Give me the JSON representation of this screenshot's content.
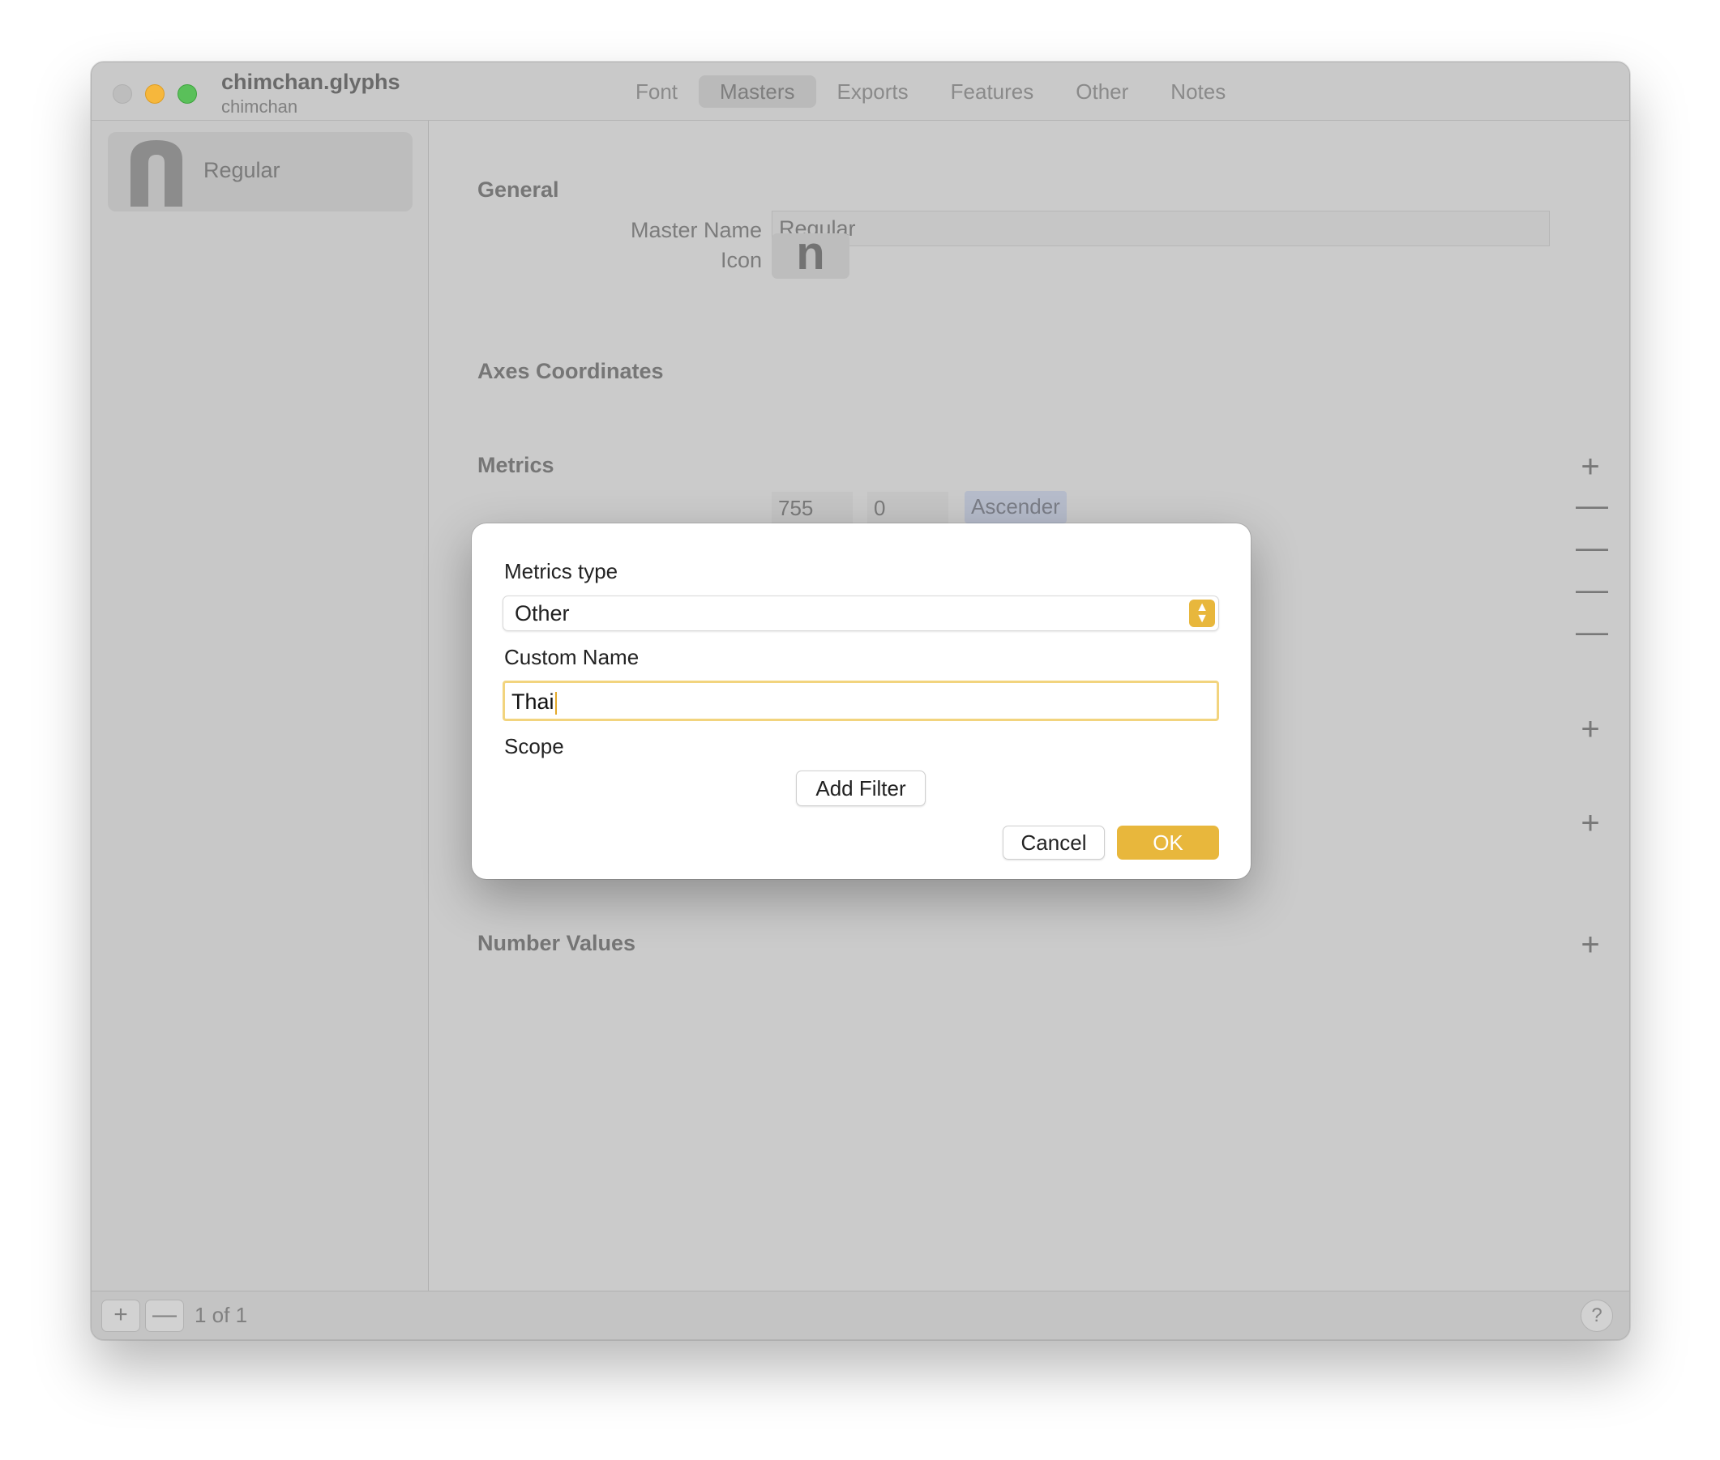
{
  "window": {
    "title": "chimchan.glyphs",
    "subtitle": "chimchan"
  },
  "tabs": [
    {
      "label": "Font",
      "active": false
    },
    {
      "label": "Masters",
      "active": true
    },
    {
      "label": "Exports",
      "active": false
    },
    {
      "label": "Features",
      "active": false
    },
    {
      "label": "Other",
      "active": false
    },
    {
      "label": "Notes",
      "active": false
    }
  ],
  "sidebar": {
    "items": [
      {
        "label": "Regular",
        "icon": "master-n-glyph-icon"
      }
    ]
  },
  "bottom_bar": {
    "add_symbol": "+",
    "remove_symbol": "—",
    "counter": "1 of 1",
    "help_symbol": "?"
  },
  "main": {
    "general": {
      "title": "General",
      "master_name_label": "Master Name",
      "master_name_value": "Regular",
      "icon_label": "Icon",
      "icon_glyph": "n"
    },
    "axes": {
      "title": "Axes Coordinates"
    },
    "metrics": {
      "title": "Metrics",
      "add_symbol": "+",
      "remove_symbol": "—",
      "rows": [
        {
          "value": "755",
          "overshoot": "0",
          "name": "Ascender"
        }
      ]
    },
    "number_values": {
      "title": "Number Values"
    }
  },
  "dialog": {
    "metrics_type_label": "Metrics type",
    "metrics_type_value": "Other",
    "custom_name_label": "Custom Name",
    "custom_name_value": "Thai",
    "scope_label": "Scope",
    "add_filter_label": "Add Filter",
    "cancel_label": "Cancel",
    "ok_label": "OK"
  },
  "colors": {
    "accent": "#e8b73c",
    "dimmed_window": "#cbcbcb",
    "sheet_background": "#ffffff"
  }
}
